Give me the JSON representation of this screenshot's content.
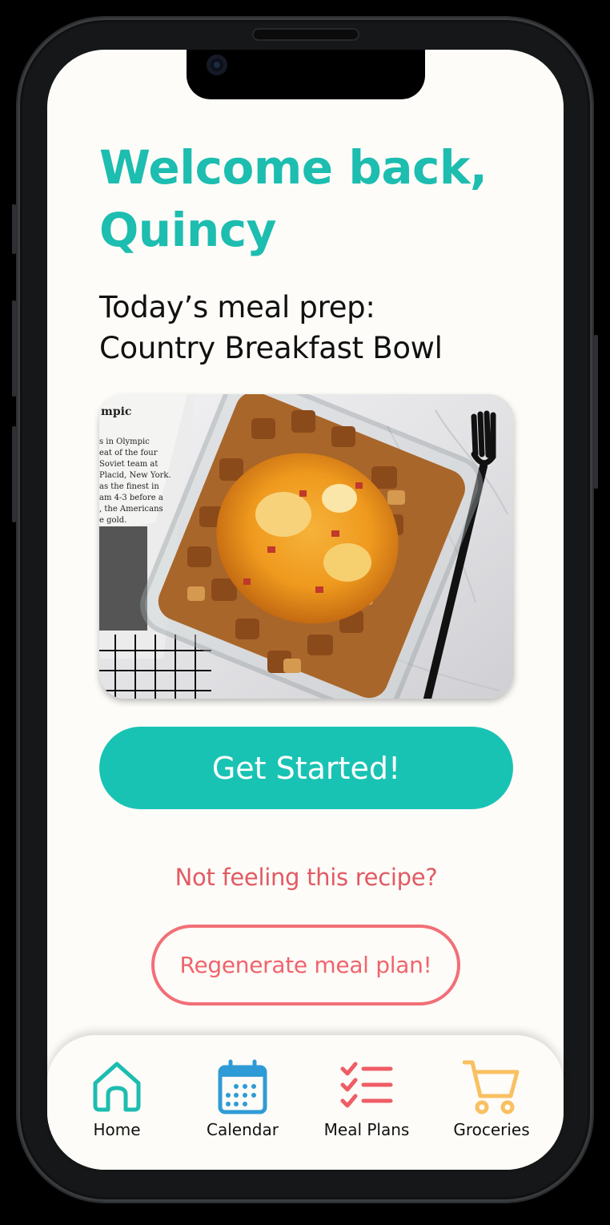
{
  "header": {
    "welcome": "Welcome back, Quincy"
  },
  "meal": {
    "prep_label": "Today’s meal prep:",
    "name": "Country Breakfast Bowl",
    "photo_icon": "breakfast-bowl-photo"
  },
  "actions": {
    "get_started": "Get Started!",
    "not_feeling": "Not feeling this recipe?",
    "regenerate": "Regenerate meal plan!"
  },
  "tabbar": {
    "items": [
      {
        "label": "Home",
        "icon": "home-icon",
        "color": "#1dbdb0"
      },
      {
        "label": "Calendar",
        "icon": "calendar-icon",
        "color": "#2f9bd6"
      },
      {
        "label": "Meal Plans",
        "icon": "checklist-icon",
        "color": "#ef5d66"
      },
      {
        "label": "Groceries",
        "icon": "cart-icon",
        "color": "#f9c062"
      }
    ]
  },
  "colors": {
    "accent": "#1dbdb0",
    "button": "#19c3b4",
    "secondary": "#f26f77",
    "background": "#fdfcf8"
  }
}
